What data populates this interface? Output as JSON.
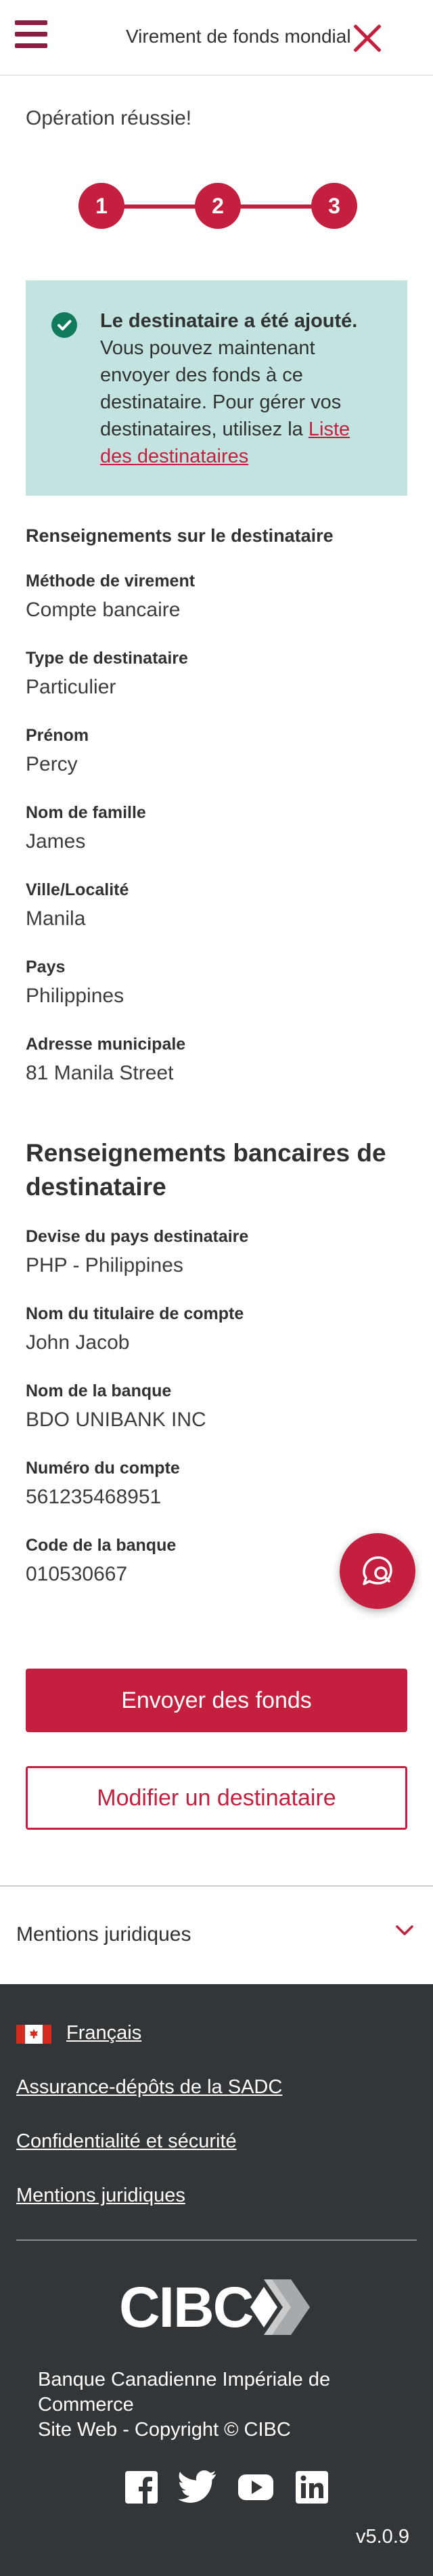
{
  "header": {
    "title": "Virement de fonds mondial",
    "menu_icon": "hamburger-icon",
    "close_icon": "close-icon"
  },
  "status": {
    "message": "Opération réussie!"
  },
  "stepper": {
    "steps": [
      "1",
      "2",
      "3"
    ],
    "current": 3
  },
  "notice": {
    "title": "Le destinataire a été ajouté.",
    "body": "Vous pouvez maintenant envoyer des fonds à ce destinataire. Pour gérer vos destinataires, utilisez la",
    "link": "Liste des destinataires"
  },
  "recipient": {
    "heading": "Renseignements sur le destinataire",
    "fields": [
      {
        "label": "Méthode de virement",
        "value": "Compte bancaire"
      },
      {
        "label": "Type de destinataire",
        "value": "Particulier"
      },
      {
        "label": "Prénom",
        "value": "Percy"
      },
      {
        "label": "Nom de famille",
        "value": "James"
      },
      {
        "label": "Ville/Localité",
        "value": "Manila"
      },
      {
        "label": "Pays",
        "value": "Philippines"
      },
      {
        "label": "Adresse municipale",
        "value": "81 Manila Street"
      }
    ]
  },
  "bank": {
    "heading": "Renseignements bancaires de destinataire",
    "fields": [
      {
        "label": "Devise du pays destinataire",
        "value": "PHP - Philippines"
      },
      {
        "label": "Nom du titulaire de compte",
        "value": "John Jacob"
      },
      {
        "label": "Nom de la banque",
        "value": "BDO UNIBANK INC"
      },
      {
        "label": "Numéro du compte",
        "value": "561235468951"
      },
      {
        "label": "Code de la banque",
        "value": "010530667"
      }
    ]
  },
  "actions": {
    "send_label": "Envoyer des fonds",
    "edit_label": "Modifier un destinataire"
  },
  "legal": {
    "label": "Mentions juridiques"
  },
  "footer": {
    "language": "Français",
    "links": [
      "Assurance-dépôts de la SADC",
      "Confidentialité et sécurité",
      "Mentions juridiques"
    ],
    "logo_text": "CIBC",
    "bank_name": "Banque Canadienne Impériale de Commerce",
    "copyright": "Site Web - Copyright © CIBC",
    "social": [
      "facebook-icon",
      "twitter-icon",
      "youtube-icon",
      "linkedin-icon"
    ],
    "version": "v5.0.9"
  },
  "colors": {
    "brand": "#c41f3e",
    "menu": "#8b1d41",
    "notice_bg": "#c3e3e0",
    "check": "#107a5c",
    "footer_bg": "#333638"
  }
}
